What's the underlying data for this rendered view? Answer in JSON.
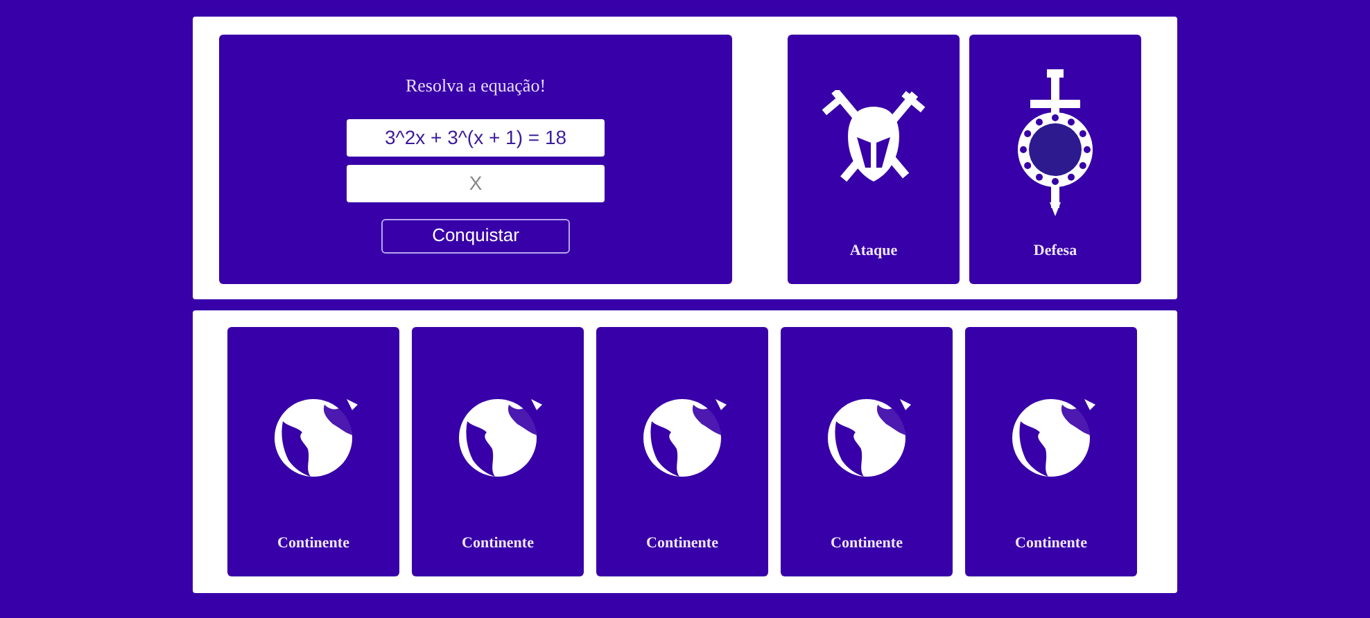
{
  "equation_card": {
    "title": "Resolva a equação!",
    "equation": "3^2x + 3^(x + 1) = 18",
    "answer_placeholder": "X",
    "button": "Conquistar"
  },
  "action_cards": [
    {
      "kind": "attack",
      "label": "Ataque"
    },
    {
      "kind": "defense",
      "label": "Defesa"
    }
  ],
  "continent_cards": [
    {
      "kind": "continent",
      "label": "Continente"
    },
    {
      "kind": "continent",
      "label": "Continente"
    },
    {
      "kind": "continent",
      "label": "Continente"
    },
    {
      "kind": "continent",
      "label": "Continente"
    },
    {
      "kind": "continent",
      "label": "Continente"
    }
  ]
}
